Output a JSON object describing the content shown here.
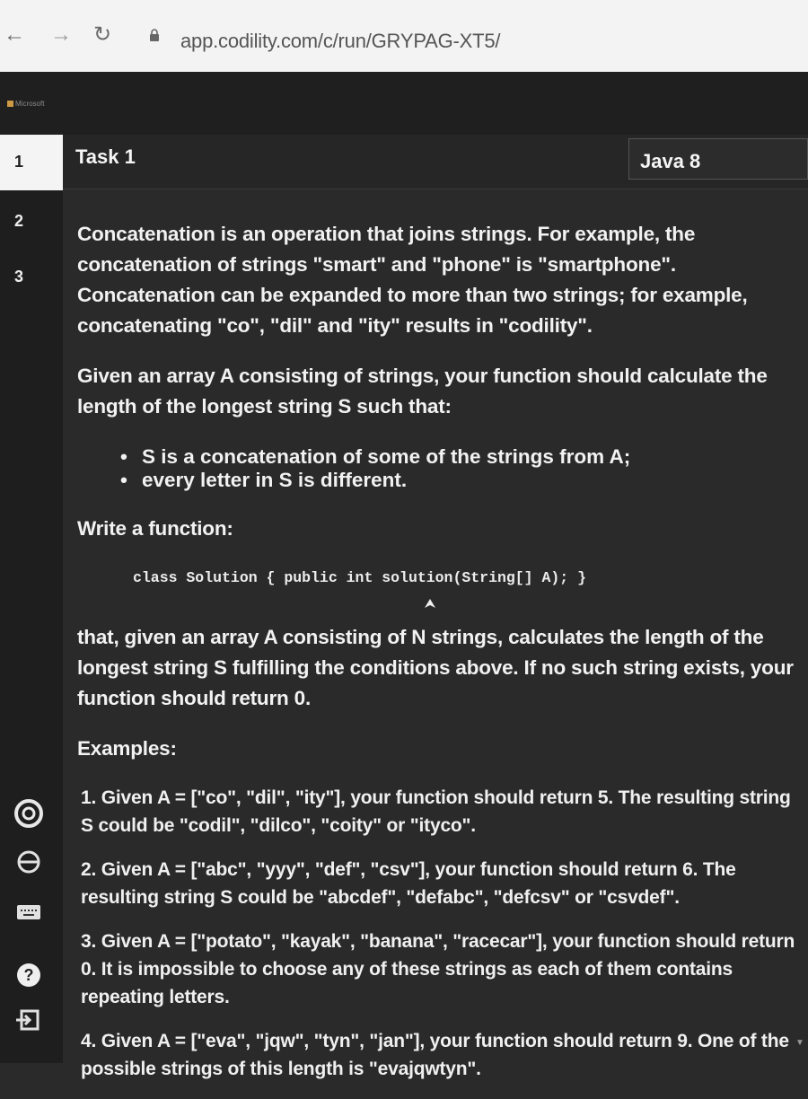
{
  "browser": {
    "url": "app.codility.com/c/run/GRYPAG-XT5/"
  },
  "ms_strip": {
    "logo_text": "Microsoft"
  },
  "sidebar": {
    "tasks": [
      {
        "label": "1"
      },
      {
        "label": "2"
      },
      {
        "label": "3"
      }
    ]
  },
  "header": {
    "task_title": "Task 1",
    "language": "Java 8"
  },
  "problem": {
    "para1": "Concatenation is an operation that joins strings. For example, the concatenation of strings \"smart\" and \"phone\" is \"smartphone\". Concatenation can be expanded to more than two strings; for example, concatenating \"co\", \"dil\" and \"ity\" results in \"codility\".",
    "para2": "Given an array A consisting of strings, your function should calculate the length of the longest string S such that:",
    "bullet1": "S is a concatenation of some of the strings from A;",
    "bullet2": "every letter in S is different.",
    "write_function": "Write a function:",
    "code": "class Solution { public int solution(String[] A); }",
    "para3": "that, given an array A consisting of N strings, calculates the length of the longest string S fulfilling the conditions above. If no such string exists, your function should return 0.",
    "examples_heading": "Examples:",
    "example1": "1. Given A = [\"co\", \"dil\", \"ity\"], your function should return 5. The resulting string S could be \"codil\", \"dilco\", \"coity\" or \"ityco\".",
    "example2": "2. Given A = [\"abc\", \"yyy\", \"def\", \"csv\"], your function should return 6. The resulting string S could be \"abcdef\", \"defabc\", \"defcsv\" or \"csvdef\".",
    "example3": "3. Given A = [\"potato\", \"kayak\", \"banana\", \"racecar\"], your function should return 0. It is impossible to choose any of these strings as each of them contains repeating letters.",
    "example4": "4. Given A = [\"eva\", \"jqw\", \"tyn\", \"jan\"], your function should return 9. One of the possible strings of this length is \"evajqwtyn\"."
  },
  "icons": {
    "rail": [
      "settings-icon",
      "accessibility-icon",
      "keyboard-icon",
      "help-icon",
      "exit-icon"
    ]
  }
}
